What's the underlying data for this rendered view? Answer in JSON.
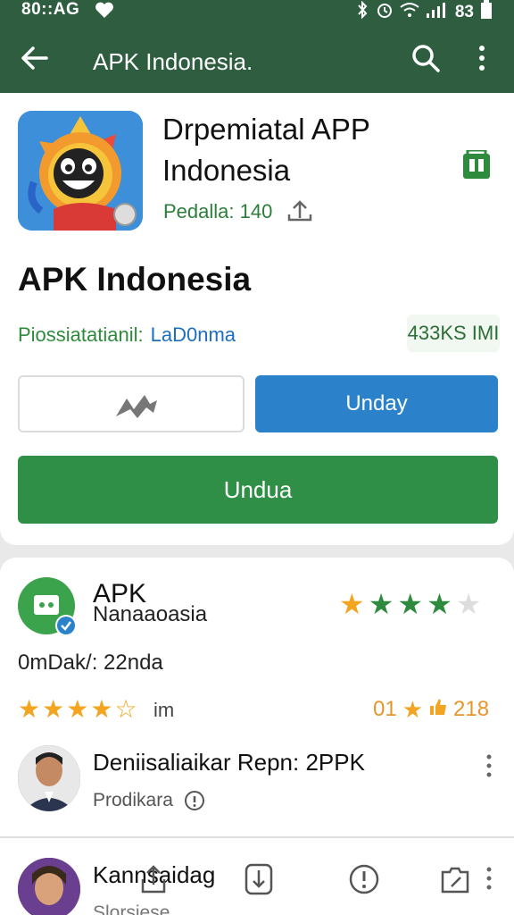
{
  "status_bar": {
    "time": "80::AG",
    "network": "83"
  },
  "app_bar": {
    "title": "APK Indonesia."
  },
  "app": {
    "name": "Drpemiatal APP Indonesia",
    "publisher_label": "Pedalla: 140"
  },
  "details": {
    "heading": "APK Indonesia",
    "info_label": "Piossiatatianil:",
    "info_value": "LaD0nma",
    "size": "433KS IMI"
  },
  "buttons": {
    "unday": "Unday",
    "unduh": "Undua"
  },
  "developer": {
    "name_line1": "APK",
    "name_line2": "Nanaaoasia",
    "meta": "0mDak/: 22nda",
    "rating_label": "im",
    "review_count_left": "01",
    "review_count_right": "218"
  },
  "reviews": [
    {
      "title": "Deniisaliaikar Repn: 2PPK",
      "subtitle": "Prodikara"
    },
    {
      "title": "Kannsaidag",
      "subtitle": "Slorsiese"
    }
  ],
  "colors": {
    "brand_green": "#2e5e3f",
    "action_blue": "#2b82cb",
    "download_green": "#2f8f46",
    "star_orange": "#f3a521",
    "star_green": "#2e8a3c"
  }
}
